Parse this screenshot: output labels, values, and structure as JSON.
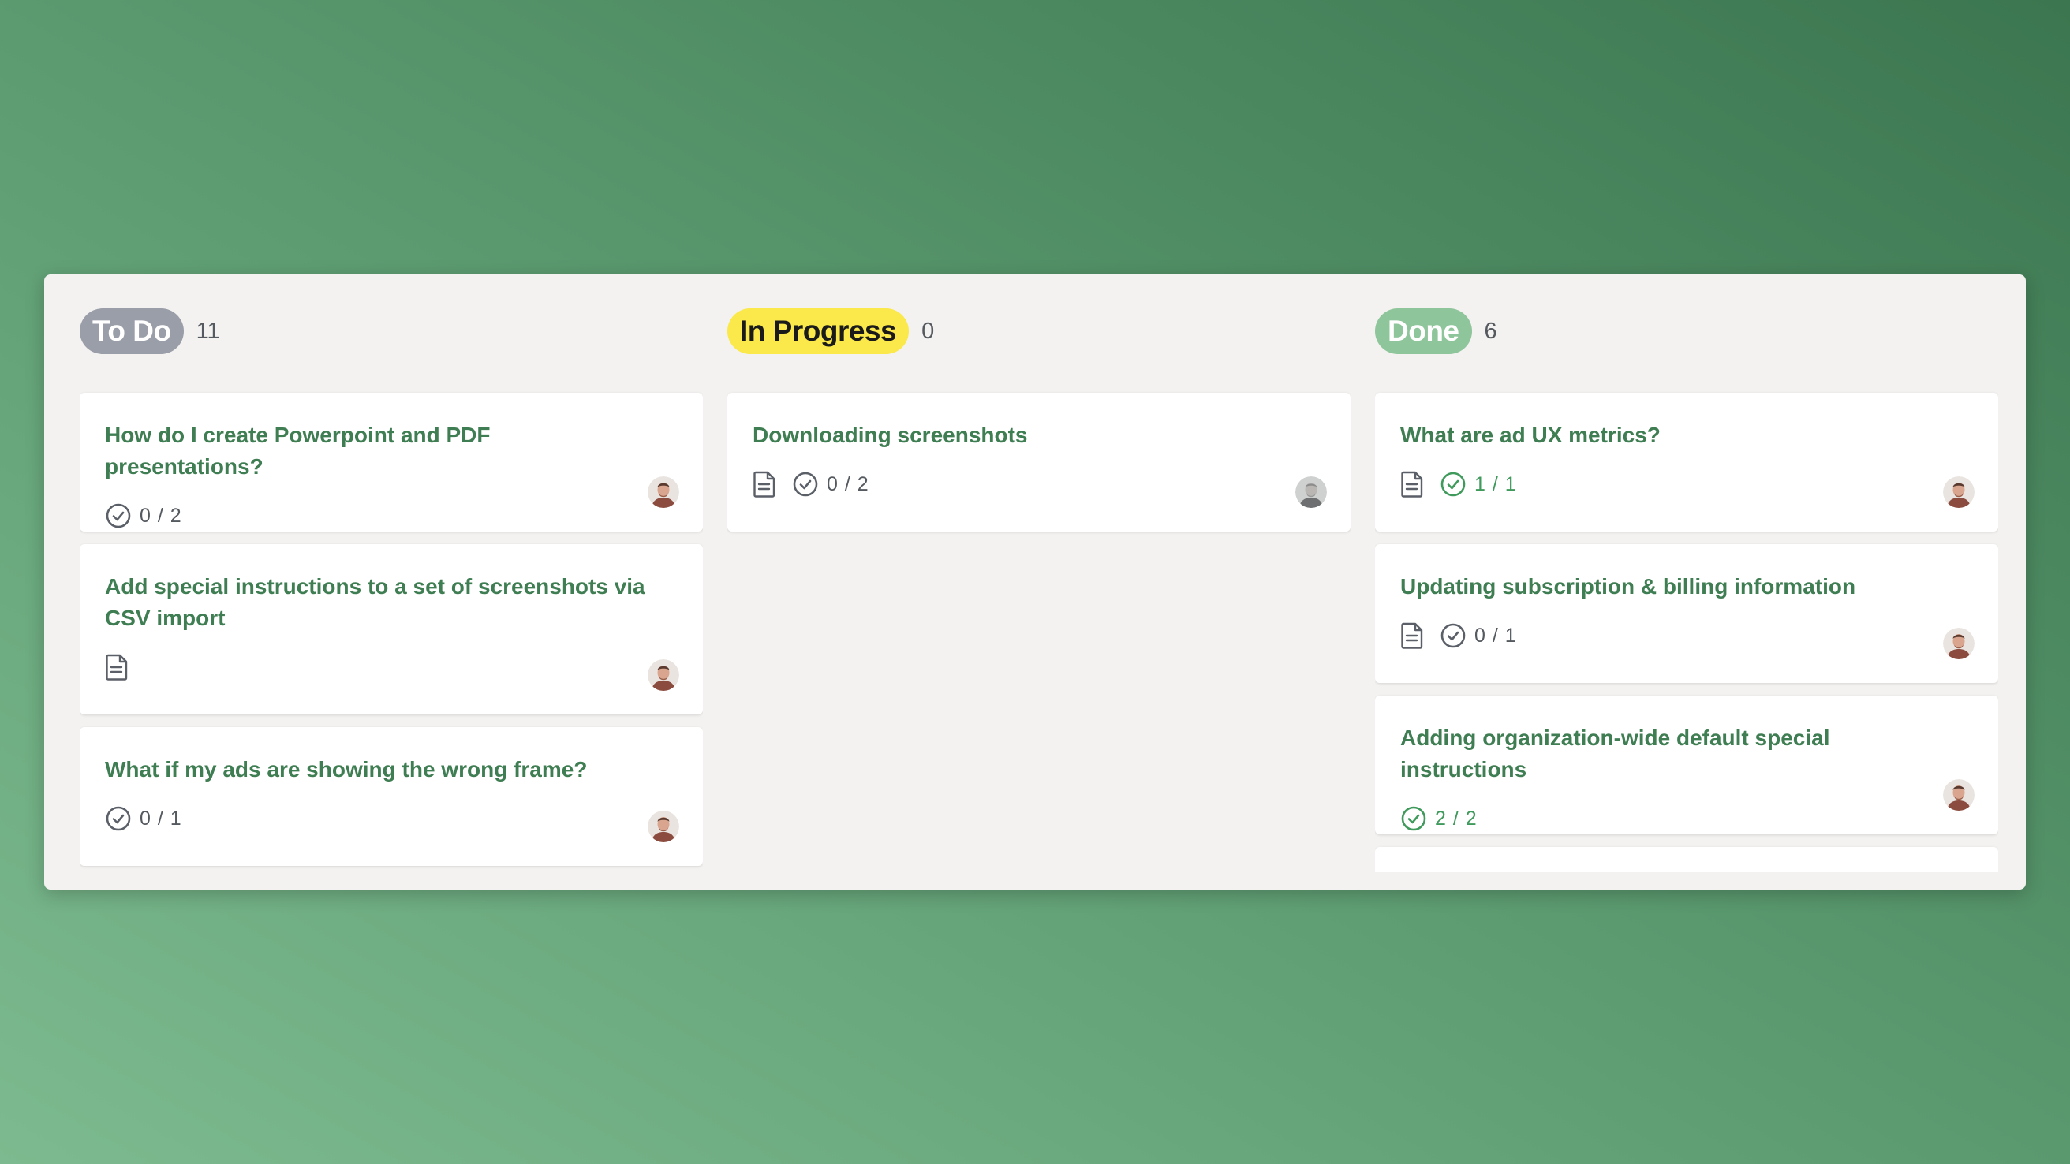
{
  "columns": [
    {
      "name": "To Do",
      "count": "11",
      "cards": [
        {
          "title": "How do I create Powerpoint and PDF presentations?",
          "has_doc": false,
          "checklist": "0 / 2",
          "checklist_complete": false,
          "avatar": "avatar-man-a"
        },
        {
          "title": "Add special instructions to a set of screenshots via CSV import",
          "has_doc": true,
          "checklist": "",
          "checklist_complete": false,
          "avatar": "avatar-man-a"
        },
        {
          "title": "What if my ads are showing the wrong frame?",
          "has_doc": false,
          "checklist": "0 / 1",
          "checklist_complete": false,
          "avatar": "avatar-man-a"
        }
      ]
    },
    {
      "name": "In Progress",
      "count": "0",
      "cards": [
        {
          "title": "Downloading screenshots",
          "has_doc": true,
          "checklist": "0 / 2",
          "checklist_complete": false,
          "avatar": "avatar-man-b"
        }
      ]
    },
    {
      "name": "Done",
      "count": "6",
      "cards": [
        {
          "title": "What are ad UX metrics?",
          "has_doc": true,
          "checklist": "1 / 1",
          "checklist_complete": true,
          "avatar": "avatar-man-a"
        },
        {
          "title": "Updating subscription & billing information",
          "has_doc": true,
          "checklist": "0 / 1",
          "checklist_complete": false,
          "avatar": "avatar-man-a"
        },
        {
          "title": "Adding organization-wide default special instructions",
          "has_doc": false,
          "checklist": "2 / 2",
          "checklist_complete": true,
          "avatar": "avatar-man-a"
        }
      ]
    }
  ],
  "colors": {
    "todo_pill": "#9a9ea9",
    "in_progress_pill": "#fbe84a",
    "done_pill": "#8ec59a",
    "card_title": "#3f7d52",
    "checklist_complete": "#3f9a5c"
  }
}
